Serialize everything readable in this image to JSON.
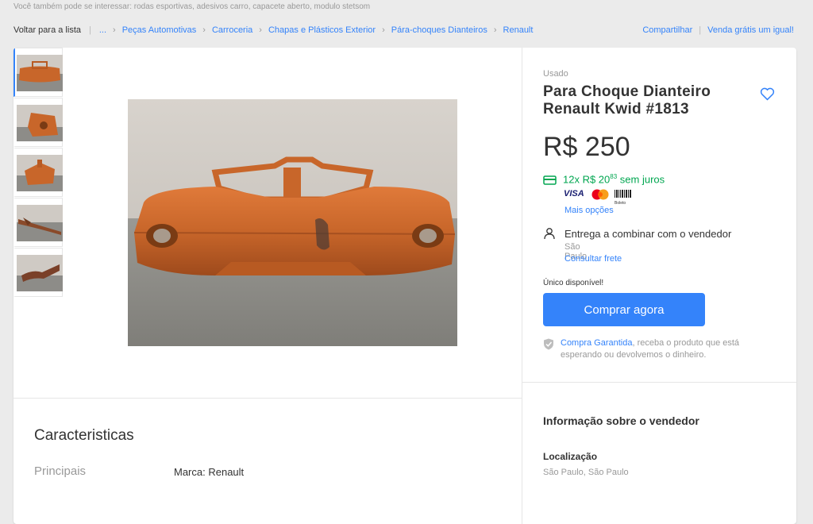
{
  "interest": {
    "text": "Você também pode se interessar: rodas esportivas, adesivos carro, capacete aberto, modulo stetsom"
  },
  "breadcrumb": {
    "back": "Voltar para a lista",
    "ellipsis": "...",
    "items": [
      "Peças Automotivas",
      "Carroceria",
      "Chapas e Plásticos Exterior",
      "Pára-choques Dianteiros",
      "Renault"
    ]
  },
  "actions": {
    "share": "Compartilhar",
    "sell": "Venda grátis um igual!"
  },
  "gallery": {
    "thumbnail_count": 5,
    "selected_index": 0
  },
  "product": {
    "condition": "Usado",
    "title": "Para Choque Dianteiro Renault Kwid #1813",
    "price": "R$ 250",
    "installments_prefix": "12x R$ 20",
    "installments_cents": "83",
    "installments_suffix": " sem juros",
    "payment_visa": "VISA",
    "payment_boleto": "Boleto",
    "more_options": "Mais opções",
    "delivery": "Entrega a combinar com o vendedor",
    "delivery_city": "São Paulo",
    "freight_link": "Consultar frete",
    "stock": "Único disponível!",
    "buy_button": "Comprar agora",
    "guarantee_link": "Compra Garantida",
    "guarantee_text": ", receba o produto que está esperando ou devolvemos o dinheiro."
  },
  "seller": {
    "title": "Informação sobre o vendedor",
    "location_label": "Localização",
    "location_value": "São Paulo, São Paulo"
  },
  "characteristics": {
    "title": "Caracteristicas",
    "section": "Principais",
    "brand_label": "Marca: Renault"
  },
  "colors": {
    "accent": "#3483fa",
    "green": "#00a650",
    "bumper": "#c8662a"
  }
}
